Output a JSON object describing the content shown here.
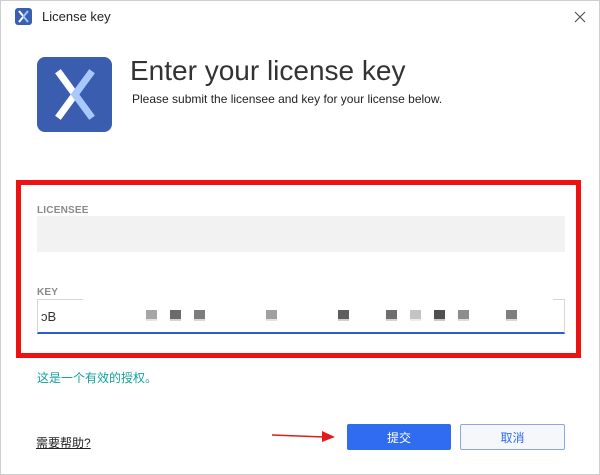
{
  "window": {
    "title": "License key",
    "close_glyph": "✕"
  },
  "header": {
    "heading": "Enter your license key",
    "subheading": "Please submit the licensee and key for your license below."
  },
  "licensee": {
    "label": "LICENSEE",
    "value": ""
  },
  "key": {
    "label": "KEY",
    "value": "ɔB"
  },
  "status": {
    "message": "这是一个有效的授权。"
  },
  "footer": {
    "help_link": "需要帮助?",
    "submit_label": "提交",
    "cancel_label": "取消"
  },
  "colors": {
    "brand_blue": "#3a5daf",
    "primary_button": "#2f6cf0",
    "valid_text": "#13a39a",
    "annotation_red": "#ee1111"
  },
  "icons": {
    "app_logo": "xmanager-x-logo",
    "close": "close-icon",
    "annotation_arrow": "red-arrow-icon"
  }
}
